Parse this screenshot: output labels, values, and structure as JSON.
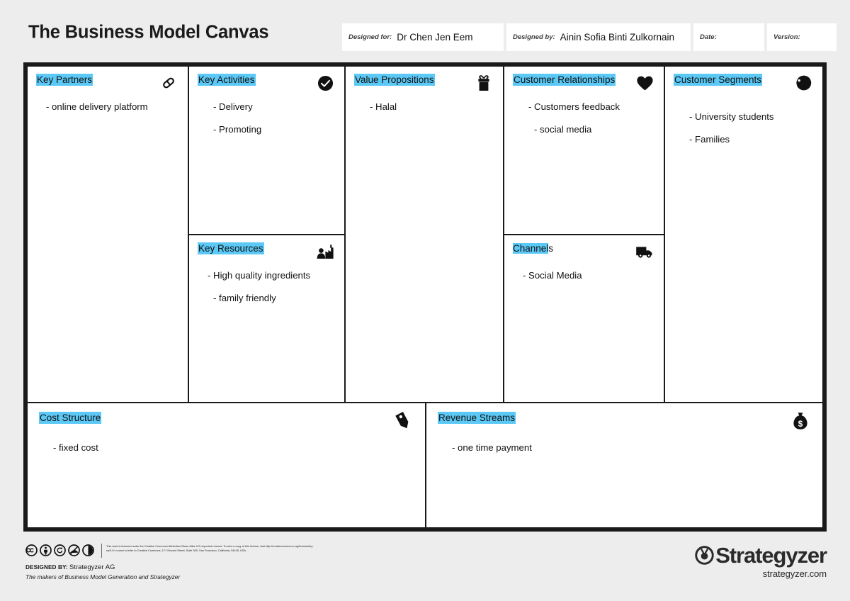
{
  "header": {
    "title": "The Business Model Canvas",
    "fields": [
      {
        "label": "Designed for:",
        "value": "Dr Chen Jen Eem",
        "name": "designed-for"
      },
      {
        "label": "Designed by:",
        "value": "Ainin Sofia Binti Zulkornain",
        "name": "designed-by"
      },
      {
        "label": "Date:",
        "value": "",
        "name": "date"
      },
      {
        "label": "Version:",
        "value": "",
        "name": "version"
      }
    ]
  },
  "blocks": {
    "key_partners": {
      "title": "Key Partners",
      "icon": "chain-link-icon",
      "items": [
        "- online delivery platform"
      ]
    },
    "key_activities": {
      "title": "Key Activities",
      "icon": "check-circle-icon",
      "items": [
        "- Delivery",
        "- Promoting"
      ]
    },
    "key_resources": {
      "title": "Key Resources",
      "icon": "factory-icon",
      "items": [
        "- High quality ingredients",
        "- family friendly"
      ]
    },
    "value_propositions": {
      "title": "Value Propositions",
      "icon": "gift-icon",
      "items": [
        "- Halal"
      ]
    },
    "customer_relationships": {
      "title": "Customer Relationships",
      "icon": "heart-icon",
      "items": [
        "- Customers feedback",
        "- social media"
      ]
    },
    "channels": {
      "title": "Channels",
      "title_highlight": "Channel",
      "title_rest": "s",
      "icon": "truck-icon",
      "items": [
        "- Social Media"
      ]
    },
    "customer_segments": {
      "title": "Customer Segments",
      "icon": "person-head-icon",
      "items": [
        "- University students",
        "- Families"
      ]
    },
    "cost_structure": {
      "title": "Cost Structure",
      "icon": "price-tag-icon",
      "items": [
        "- fixed cost"
      ]
    },
    "revenue_streams": {
      "title": "Revenue Streams",
      "icon": "money-bag-icon",
      "items": [
        "- one time payment"
      ]
    }
  },
  "footer": {
    "license_text": "This work is licensed under the Creative Commons Attribution-Share Alike 3.0 Unported License. To view a copy of this license, visit http://creativecommons.org/licenses/by-sa/3.0/ or send a letter to Creative Commons, 171 Second Street, Suite 300, San Francisco, California, 94105, USA.",
    "designed_by_label": "DESIGNED BY:",
    "designed_by_value": "Strategyzer AG",
    "makers": "The makers of Business Model Generation and Strategyzer",
    "brand_name": "Strategyzer",
    "brand_url": "strategyzer.com",
    "cc_badges": [
      "creative-commons-icon",
      "attribution-icon",
      "share-alike-icon",
      "non-commercial-icon",
      "half-circle-icon"
    ]
  },
  "colors": {
    "highlight": "#5bc8f5",
    "page_background": "#ededed",
    "frame": "#1a1a1a"
  }
}
